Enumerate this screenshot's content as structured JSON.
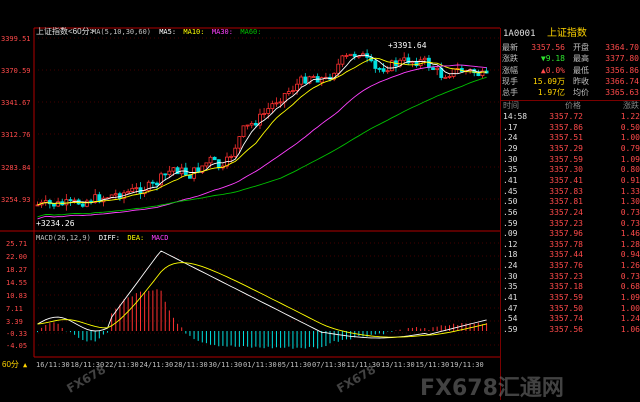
{
  "chart_title": "上证指数<60分>",
  "ma_legend": [
    {
      "label": "MA(5,10,30,60)",
      "color": "#c0c0c0"
    },
    {
      "label": "MA5:",
      "color": "#ffffff"
    },
    {
      "label": "MA10:",
      "color": "#ffff00"
    },
    {
      "label": "MA30:",
      "color": "#ff40ff"
    },
    {
      "label": "MA60:",
      "color": "#00c000"
    }
  ],
  "macd_legend": [
    {
      "label": "MACD(26,12,9)",
      "color": "#c0c0c0"
    },
    {
      "label": "DIFF:",
      "color": "#ffffff"
    },
    {
      "label": "DEA:",
      "color": "#ffff00"
    },
    {
      "label": "MACD",
      "color": "#ff40ff"
    }
  ],
  "price_axis": [
    "3399.51",
    "3370.59",
    "3341.67",
    "3312.76",
    "3283.84",
    "3254.93"
  ],
  "macd_axis": [
    "25.71",
    "22.00",
    "18.27",
    "14.55",
    "10.83",
    "7.11",
    "3.39",
    "-0.33",
    "-4.05"
  ],
  "annotations": {
    "high": "+3391.64",
    "low": "+3234.26"
  },
  "period_label": "60分",
  "period_arrow": "▲",
  "x_dates": [
    "16/11:30",
    "18/11:30",
    "22/11:30",
    "24/11:30",
    "28/11:30",
    "30/11:30",
    "01/11:30",
    "05/11:30",
    "07/11:30",
    "11/11:30",
    "13/11:30",
    "15/11:30",
    "19/11:30"
  ],
  "quote": {
    "code": "1A0001",
    "name": "上证指数",
    "rows": [
      {
        "l1": "最新",
        "v1": "3357.56",
        "c1": "red",
        "l2": "开盘",
        "v2": "3364.70",
        "c2": "red"
      },
      {
        "l1": "涨跌",
        "v1": "▼9.18",
        "c1": "grn",
        "l2": "最高",
        "v2": "3377.80",
        "c2": "red"
      },
      {
        "l1": "涨幅",
        "v1": "▲0.0%",
        "c1": "red",
        "l2": "最低",
        "v2": "3356.86",
        "c2": "red"
      },
      {
        "l1": "现手",
        "v1": "15.09万",
        "c1": "yel",
        "l2": "昨收",
        "v2": "3366.74",
        "c2": "red"
      },
      {
        "l1": "总手",
        "v1": "1.97亿",
        "c1": "yel",
        "l2": "均价",
        "v2": "3365.63",
        "c2": "red"
      }
    ]
  },
  "ticks_header": {
    "time": "时间",
    "price": "价格",
    "chg": "涨跌"
  },
  "ticks": [
    {
      "t": "14:58",
      "p": "3357.72",
      "c": "1.22"
    },
    {
      "t": ".17",
      "p": "3357.86",
      "c": "0.50"
    },
    {
      "t": ".24",
      "p": "3357.51",
      "c": "1.00"
    },
    {
      "t": ".29",
      "p": "3357.29",
      "c": "0.79"
    },
    {
      "t": ".30",
      "p": "3357.59",
      "c": "1.09"
    },
    {
      "t": ".35",
      "p": "3357.30",
      "c": "0.80"
    },
    {
      "t": ".41",
      "p": "3357.41",
      "c": "0.91"
    },
    {
      "t": ".45",
      "p": "3357.83",
      "c": "1.33"
    },
    {
      "t": ".50",
      "p": "3357.81",
      "c": "1.30"
    },
    {
      "t": ".56",
      "p": "3357.24",
      "c": "0.73"
    },
    {
      "t": ".59",
      "p": "3357.23",
      "c": "0.73"
    },
    {
      "t": ".09",
      "p": "3357.96",
      "c": "1.46"
    },
    {
      "t": ".12",
      "p": "3357.78",
      "c": "1.28"
    },
    {
      "t": ".18",
      "p": "3357.44",
      "c": "0.94"
    },
    {
      "t": ".24",
      "p": "3357.76",
      "c": "1.26"
    },
    {
      "t": ".30",
      "p": "3357.23",
      "c": "0.73"
    },
    {
      "t": ".35",
      "p": "3357.18",
      "c": "0.68"
    },
    {
      "t": ".41",
      "p": "3357.59",
      "c": "1.09"
    },
    {
      "t": ".47",
      "p": "3357.50",
      "c": "1.00"
    },
    {
      "t": ".54",
      "p": "3357.74",
      "c": "1.24"
    },
    {
      "t": ".59",
      "p": "3357.56",
      "c": "1.06"
    }
  ],
  "watermarks": [
    {
      "text": "FX678汇通网"
    },
    {
      "text": "FX678"
    },
    {
      "text": "FX678"
    }
  ],
  "colors": {
    "up": "#ff3030",
    "down": "#00e0e0",
    "axis": "#b00000",
    "grid": "#5a0000",
    "ma5": "#ffffff",
    "ma10": "#ffff00",
    "ma30": "#ff40ff",
    "ma60": "#00c000"
  }
}
